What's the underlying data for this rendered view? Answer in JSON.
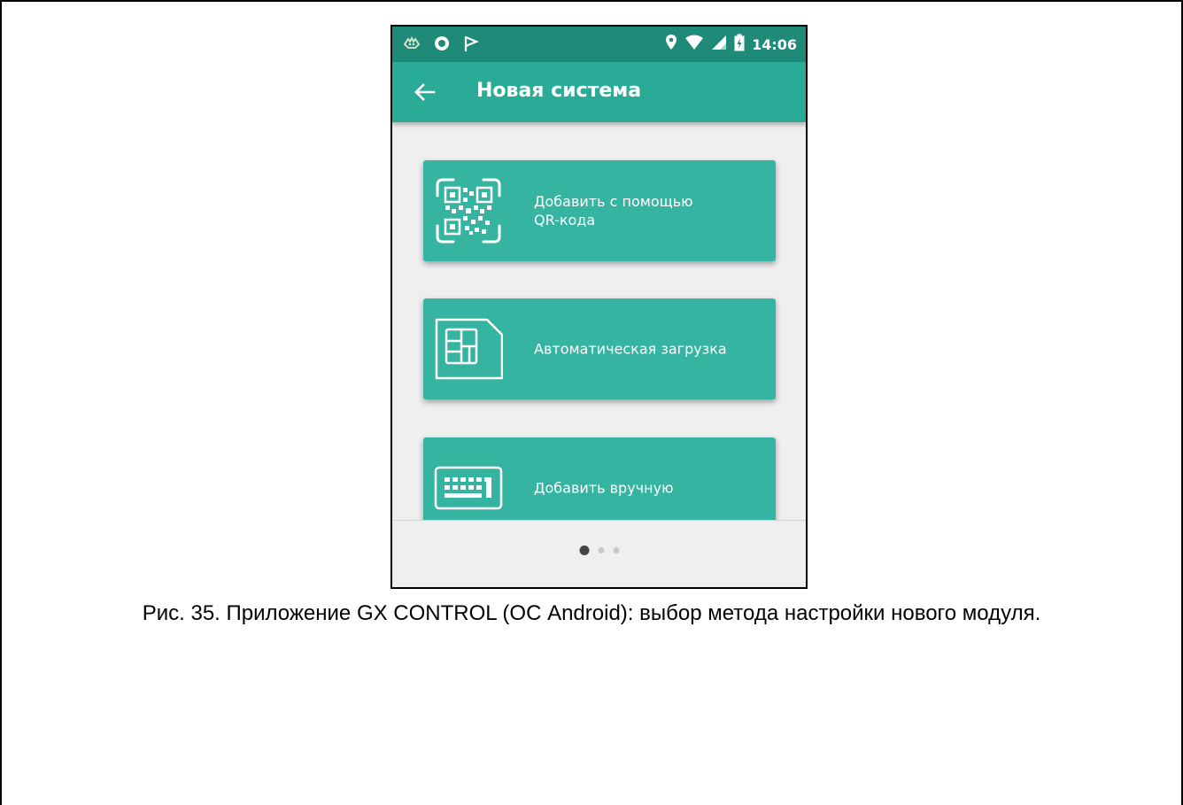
{
  "status_bar": {
    "left_icons": [
      "ghost-app-icon",
      "record-icon",
      "check-flag-icon"
    ],
    "right_icons": [
      "location-icon",
      "wifi-icon",
      "signal-icon",
      "battery-icon"
    ],
    "time": "14:06"
  },
  "app_bar": {
    "back_icon": "arrow-left-icon",
    "title": "Новая система"
  },
  "options": [
    {
      "icon": "qr-code-icon",
      "label": "Добавить с помощью\nQR-кода"
    },
    {
      "icon": "sim-card-icon",
      "label": "Автоматическая загрузка"
    },
    {
      "icon": "keyboard-icon",
      "label": "Добавить вручную"
    }
  ],
  "pager": {
    "pages": 3,
    "active": 1
  },
  "caption": "Рис. 35. Приложение GX CONTROL (ОС Android): выбор метода настройки нового модуля.",
  "colors": {
    "status_bar": "#1f8a78",
    "app_bar": "#2aab97",
    "card": "#35b4a2",
    "screen_bg": "#efefef"
  }
}
